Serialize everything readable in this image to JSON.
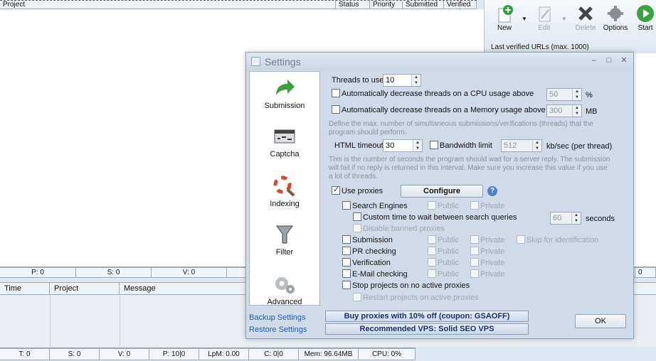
{
  "main": {
    "project_columns": [
      "Project",
      "Status",
      "Priority",
      "Submitted",
      "Verified"
    ],
    "toolbar": {
      "new": "New",
      "edit": "Edit",
      "delete": "Delete",
      "options": "Options",
      "start": "Start"
    },
    "last_verified_label": "Last verified URLs (max. 1000)",
    "status1": [
      "P: 0",
      "S: 0",
      "V: 0",
      "",
      "",
      "",
      "0"
    ],
    "log_columns": [
      "Time",
      "Project",
      "Message"
    ],
    "status2": [
      "T: 0",
      "S: 0",
      "V: 0",
      "P: 10|0",
      "LpM: 0.00",
      "C: 0|0",
      "Mem: 96.64MB",
      "CPU: 0%"
    ]
  },
  "settings": {
    "title": "Settings",
    "nav": {
      "submission": "Submission",
      "captcha": "Captcha",
      "indexing": "Indexing",
      "filter": "Filter",
      "advanced": "Advanced",
      "backup": "Backup Settings",
      "restore": "Restore Settings"
    },
    "threads_label": "Threads to use",
    "threads_value": "10",
    "cpu_label": "Automatically decrease threads on a CPU usage above",
    "cpu_value": "50",
    "cpu_unit": "%",
    "mem_label": "Automatically decrease threads on a Memory usage above",
    "mem_value": "300",
    "mem_unit": "MB",
    "threads_desc_1": "Define the max. number of simultaneous submissions/verifications (threads) that the",
    "threads_desc_2": "program should perform.",
    "html_timeout_label": "HTML timeout",
    "html_timeout_value": "30",
    "bandwidth_label": "Bandwidth limit",
    "bandwidth_value": "512",
    "bandwidth_unit": "kb/sec (per thread)",
    "timeout_desc_1": "This is the number of seconds the program should wait for a server reply. The submission",
    "timeout_desc_2": "will fail if no reply is returned in this interval. Make sure you increase this value if you use",
    "timeout_desc_3": "a lot of threads.",
    "use_proxies": "Use proxies",
    "configure": "Configure",
    "search_engines": "Search Engines",
    "public": "Public",
    "private": "Private",
    "custom_time": "Custom time to wait between search queries",
    "custom_time_value": "60",
    "seconds": "seconds",
    "disable_banned": "Disable banned proxies",
    "submission": "Submission",
    "skip_identification": "Skip for identification",
    "pr_checking": "PR checking",
    "verification": "Verification",
    "email_checking": "E-Mail checking",
    "stop_projects": "Stop projects on no active proxies",
    "restart_projects": "Restart projects on active proxies",
    "promo_proxies": "Buy proxies with 10% off  (coupon: GSAOFF)",
    "promo_vps": "Recommended VPS: Solid SEO VPS",
    "ok": "OK"
  },
  "colors": {
    "accent_link": "#1f5fb5",
    "promo_text": "#1d2f66",
    "dialog_bg": "#cfdbe8"
  }
}
